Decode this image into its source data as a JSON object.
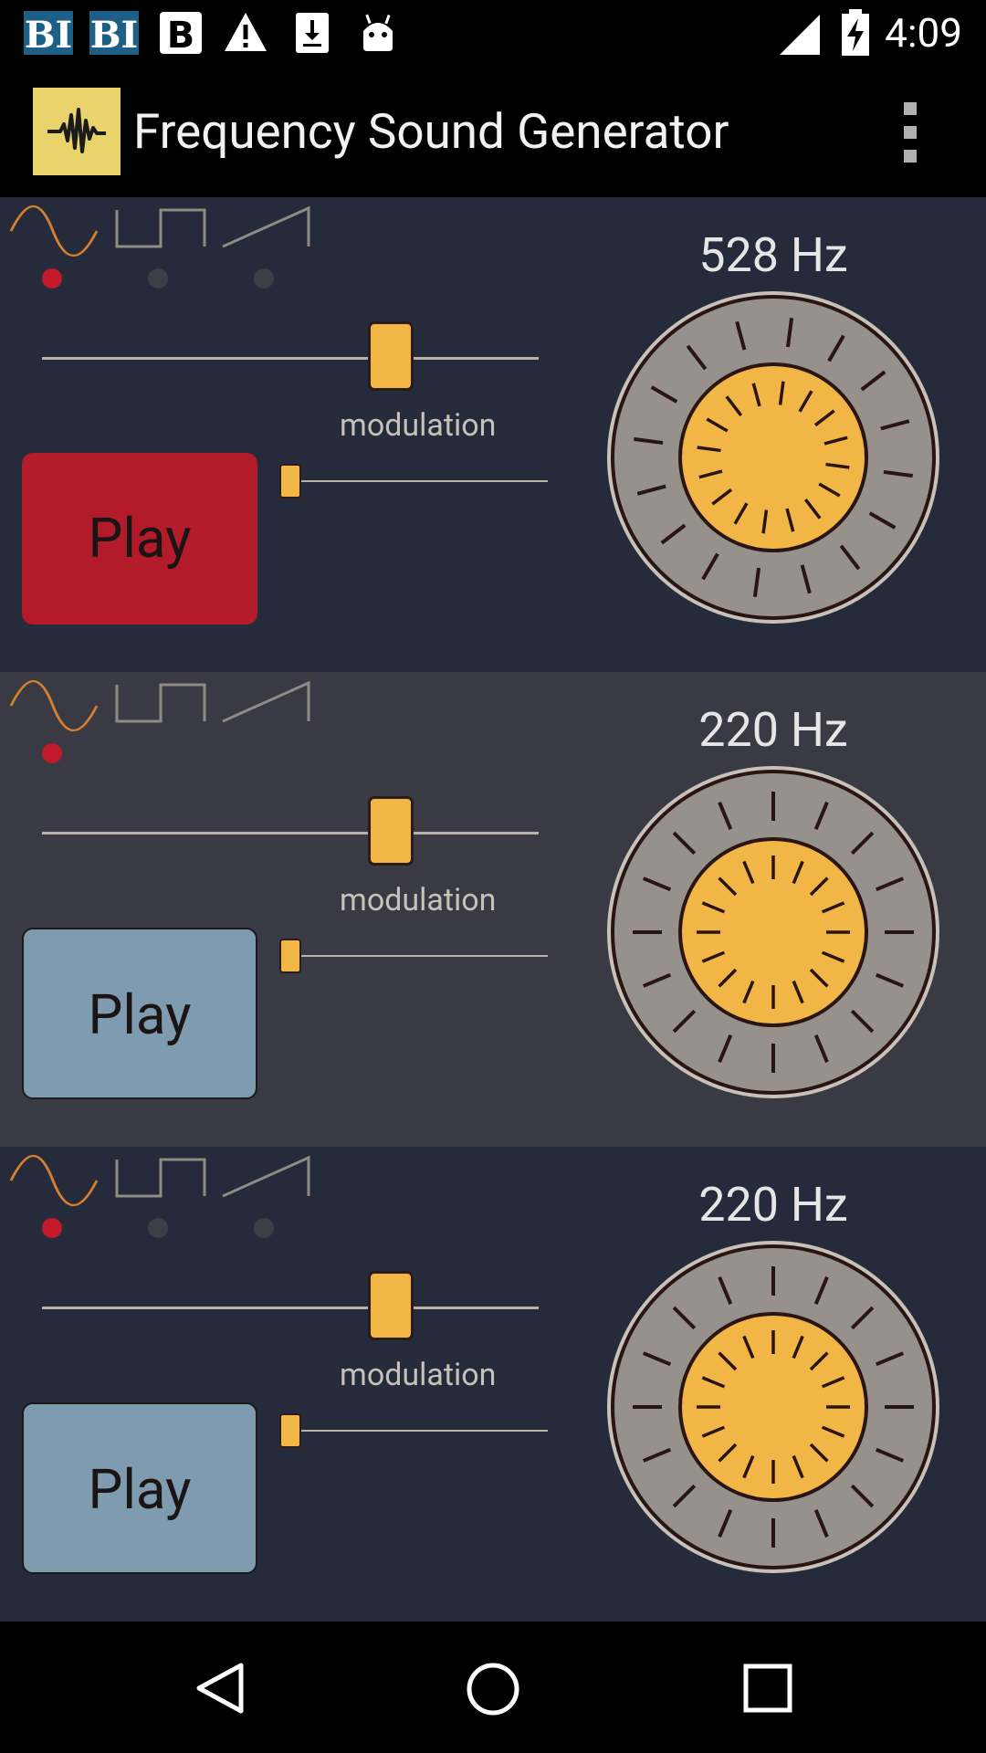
{
  "status_bar": {
    "time": "4:09",
    "notification_icons": [
      "bi-news-icon",
      "bi-news-icon",
      "blogger-icon",
      "warning-icon",
      "download-icon",
      "android-icon"
    ],
    "signal_icon": "signal-icon",
    "battery_icon": "battery-charging-icon"
  },
  "app_bar": {
    "title": "Frequency Sound Generator",
    "app_icon": "waveform-icon",
    "menu_icon": "overflow-menu-icon"
  },
  "generators": [
    {
      "frequency_label": "528 Hz",
      "waveforms": [
        "sine",
        "square",
        "sawtooth"
      ],
      "selected_waveform": "sine",
      "frequency_slider_value": 0.7,
      "play_label": "Play",
      "playing": true,
      "modulation_label": "modulation",
      "modulation_value": 0
    },
    {
      "frequency_label": "220 Hz",
      "waveforms": [
        "sine",
        "square",
        "sawtooth"
      ],
      "selected_waveform": "sine",
      "frequency_slider_value": 0.7,
      "play_label": "Play",
      "playing": false,
      "modulation_label": "modulation",
      "modulation_value": 0
    },
    {
      "frequency_label": "220 Hz",
      "waveforms": [
        "sine",
        "square",
        "sawtooth"
      ],
      "selected_waveform": "sine",
      "frequency_slider_value": 0.7,
      "play_label": "Play",
      "playing": false,
      "modulation_label": "modulation",
      "modulation_value": 0
    }
  ],
  "nav_bar": {
    "back_icon": "back-icon",
    "home_icon": "home-icon",
    "recents_icon": "recents-icon"
  },
  "colors": {
    "panel_bg_1": "#262b3c",
    "panel_bg_2": "#393a44",
    "panel_bg_3": "#262b3c",
    "active_play": "#b31b2b",
    "idle_play": "#7f9bb0",
    "knob_yellow": "#f2b646",
    "dial_gray": "#96918a",
    "selected_dot": "#c21a2a",
    "wave_selected": "#d67f2c",
    "wave_unselected": "#8e8b84"
  }
}
